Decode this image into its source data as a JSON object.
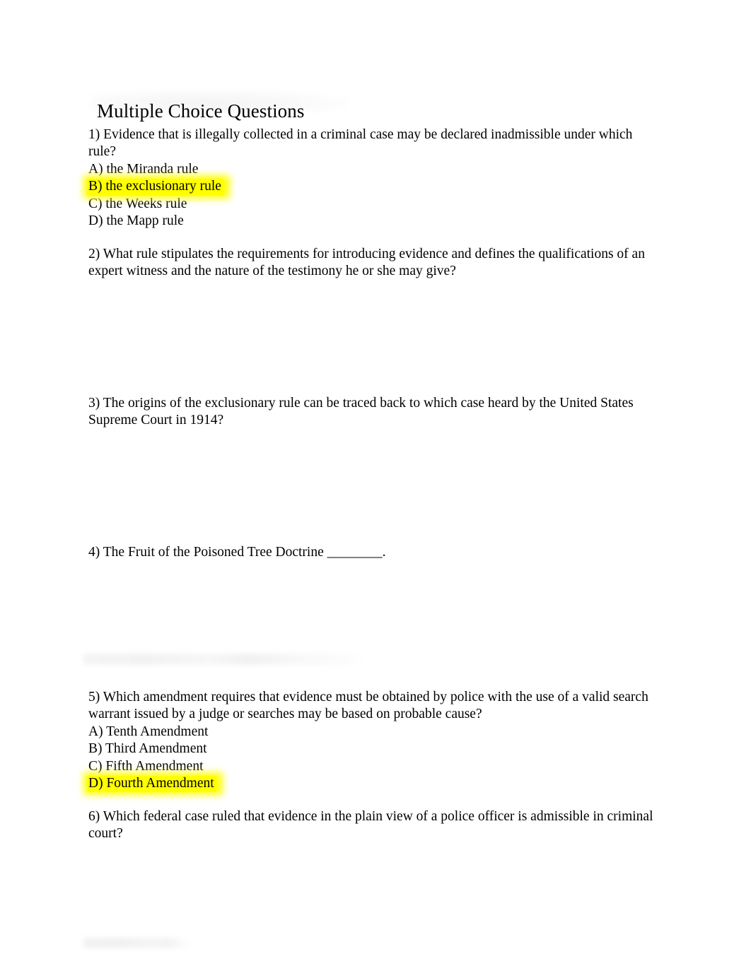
{
  "document": {
    "title": "Multiple Choice Questions",
    "highlight_color": "#ffff00",
    "text_color": "#000000",
    "background_color": "#ffffff"
  },
  "questions": [
    {
      "number": "1)",
      "prompt": "1) Evidence that is illegally collected in a criminal case may be declared inadmissible under which rule?",
      "options": [
        {
          "label": "A) the Miranda rule",
          "highlighted": false
        },
        {
          "label": "B) the exclusionary rule",
          "highlighted": true
        },
        {
          "label": "C) the Weeks rule",
          "highlighted": false
        },
        {
          "label": "D) the Mapp rule",
          "highlighted": false
        }
      ]
    },
    {
      "number": "2)",
      "prompt": "2) What rule stipulates the requirements for introducing evidence and defines the qualifications of an expert witness and the nature of the testimony he or she may give?",
      "options": []
    },
    {
      "number": "3)",
      "prompt": "3) The origins of the exclusionary rule can be traced back to which case heard by the United States Supreme Court in 1914?",
      "options": []
    },
    {
      "number": "4)",
      "prompt": "4) The Fruit of the Poisoned Tree Doctrine ________.",
      "options": []
    },
    {
      "number": "5)",
      "prompt": "5) Which amendment requires that evidence must be obtained by police with the use of a valid search warrant issued by a judge or searches may be based on probable cause?",
      "options": [
        {
          "label": "A) Tenth Amendment",
          "highlighted": false
        },
        {
          "label": "B) Third Amendment",
          "highlighted": false
        },
        {
          "label": "C) Fifth Amendment",
          "highlighted": false
        },
        {
          "label": "D) Fourth Amendment",
          "highlighted": true
        }
      ]
    },
    {
      "number": "6)",
      "prompt": "6) Which federal case ruled that evidence in the plain view of a police officer is admissible in criminal court?",
      "options": []
    }
  ]
}
